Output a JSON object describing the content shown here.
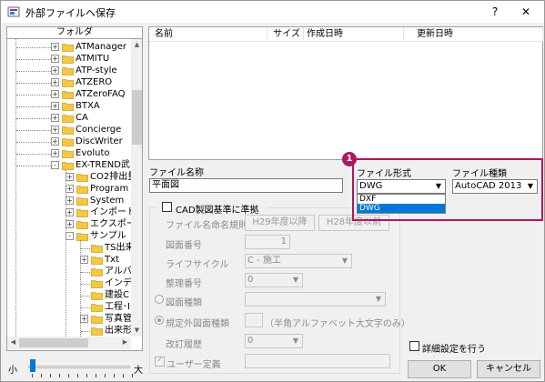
{
  "window": {
    "title": "外部ファイルへ保存",
    "help_label": "?",
    "close_label": "✕"
  },
  "folder_panel": {
    "header": "フォルダ",
    "items": [
      {
        "label": "ATManager"
      },
      {
        "label": "ATMITU"
      },
      {
        "label": "ATP-style"
      },
      {
        "label": "ATZERO"
      },
      {
        "label": "ATZeroFAQ"
      },
      {
        "label": "BTXA"
      },
      {
        "label": "CA"
      },
      {
        "label": "Concierge"
      },
      {
        "label": "DiscWriter"
      },
      {
        "label": "Evoluto"
      },
      {
        "label": "EX-TREND武"
      },
      {
        "label": "CO2排出量"
      },
      {
        "label": "Program"
      },
      {
        "label": "System"
      },
      {
        "label": "インポート"
      },
      {
        "label": "エクスポー"
      },
      {
        "label": "サンプル"
      },
      {
        "label": "TS出来"
      },
      {
        "label": "Txt"
      },
      {
        "label": "アルバ"
      },
      {
        "label": "インデ"
      },
      {
        "label": "建設C"
      },
      {
        "label": "工程･I"
      },
      {
        "label": "写真管"
      },
      {
        "label": "出来形"
      }
    ]
  },
  "slider": {
    "small_label": "小",
    "large_label": "大",
    "level": 0
  },
  "file_list": {
    "columns": [
      "名前",
      "サイズ",
      "作成日時",
      "更新日時"
    ]
  },
  "form": {
    "file_name_label": "ファイル名称",
    "file_name_value": "平面図",
    "cad_standard_label": "CAD製図基準に準拠",
    "naming_rule_label": "ファイル名命名規則",
    "h29_button": "H29年度以降",
    "h28_button": "H28年度以前",
    "drawing_number_label": "図面番号",
    "drawing_number_value": "1",
    "lifecycle_label": "ライフサイクル",
    "lifecycle_value": "C - 施工",
    "serial_label": "整理番号",
    "serial_value": "0",
    "drawing_type_label": "図面種類",
    "other_type_label": "規定外図面種類",
    "other_type_hint": "（半角アルファベット大文字のみ）",
    "revision_label": "改訂履歴",
    "revision_value": "0",
    "user_def_label": "ユーザー定義"
  },
  "file_format": {
    "label": "ファイル形式",
    "value": "DWG",
    "options": [
      "DXF",
      "DWG"
    ],
    "selected_index": 1
  },
  "file_type": {
    "label": "ファイル種類",
    "value": "AutoCAD 2013"
  },
  "callout": {
    "number": "1"
  },
  "bottom": {
    "detail_label": "詳細設定を行う",
    "ok_label": "OK",
    "cancel_label": "キャンセル"
  },
  "colors": {
    "highlight": "#b0165a",
    "selection": "#0078d7",
    "slider": "#007ad9",
    "folder": "#f5c842"
  }
}
